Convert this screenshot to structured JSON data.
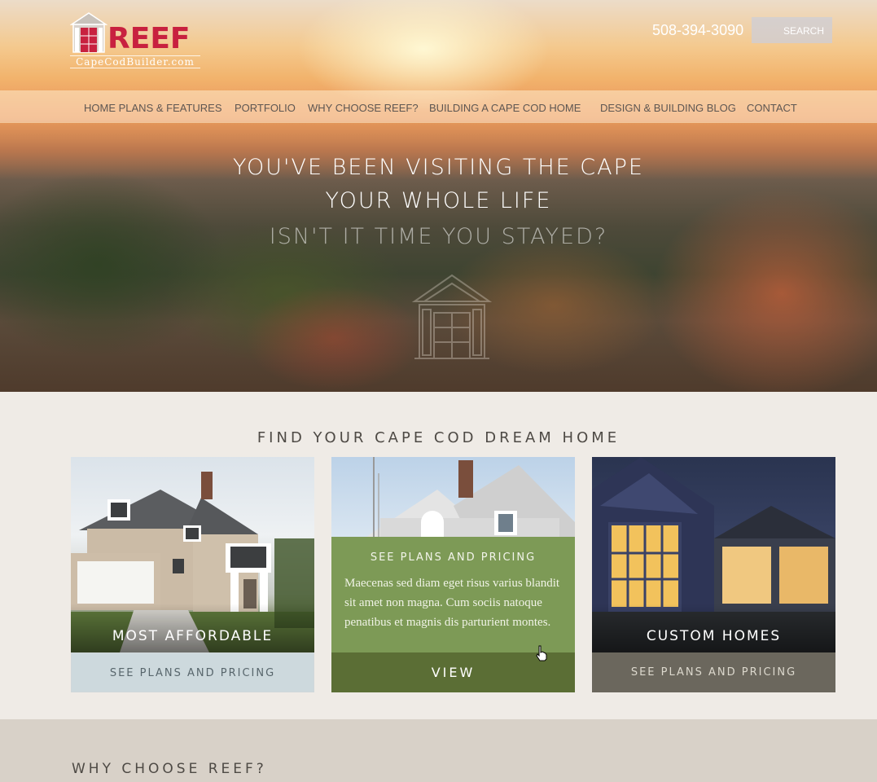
{
  "header": {
    "logo_word": "REEF",
    "logo_sub": "CapeCodBuilder.com",
    "phone": "508-394-3090",
    "search_label": "SEARCH"
  },
  "nav": {
    "items": [
      {
        "label": "HOME PLANS & FEATURES"
      },
      {
        "label": "PORTFOLIO"
      },
      {
        "label": "WHY CHOOSE REEF?"
      },
      {
        "label": "BUILDING A CAPE COD HOME"
      },
      {
        "label": "DESIGN & BUILDING BLOG"
      },
      {
        "label": "CONTACT"
      }
    ]
  },
  "hero": {
    "line1": "YOU'VE BEEN VISITING THE CAPE",
    "line2": "YOUR WHOLE LIFE",
    "line3": "ISN'T IT TIME YOU STAYED?"
  },
  "find": {
    "title": "FIND YOUR CAPE COD DREAM HOME",
    "cards": [
      {
        "label": "MOST AFFORDABLE",
        "cta": "SEE PLANS AND PRICING"
      },
      {
        "overlay_title": "SEE PLANS AND PRICING",
        "overlay_text": "Maecenas sed diam eget risus varius blandit sit amet non magna. Cum sociis natoque penatibus et magnis dis parturient montes.",
        "cta": "VIEW"
      },
      {
        "label": "CUSTOM HOMES",
        "cta": "SEE PLANS AND PRICING"
      }
    ]
  },
  "why": {
    "title": "WHY CHOOSE REEF?"
  },
  "colors": {
    "brand_red": "#c8213f",
    "accent_green": "#7d9a56",
    "dark_green": "#5b6e35"
  }
}
